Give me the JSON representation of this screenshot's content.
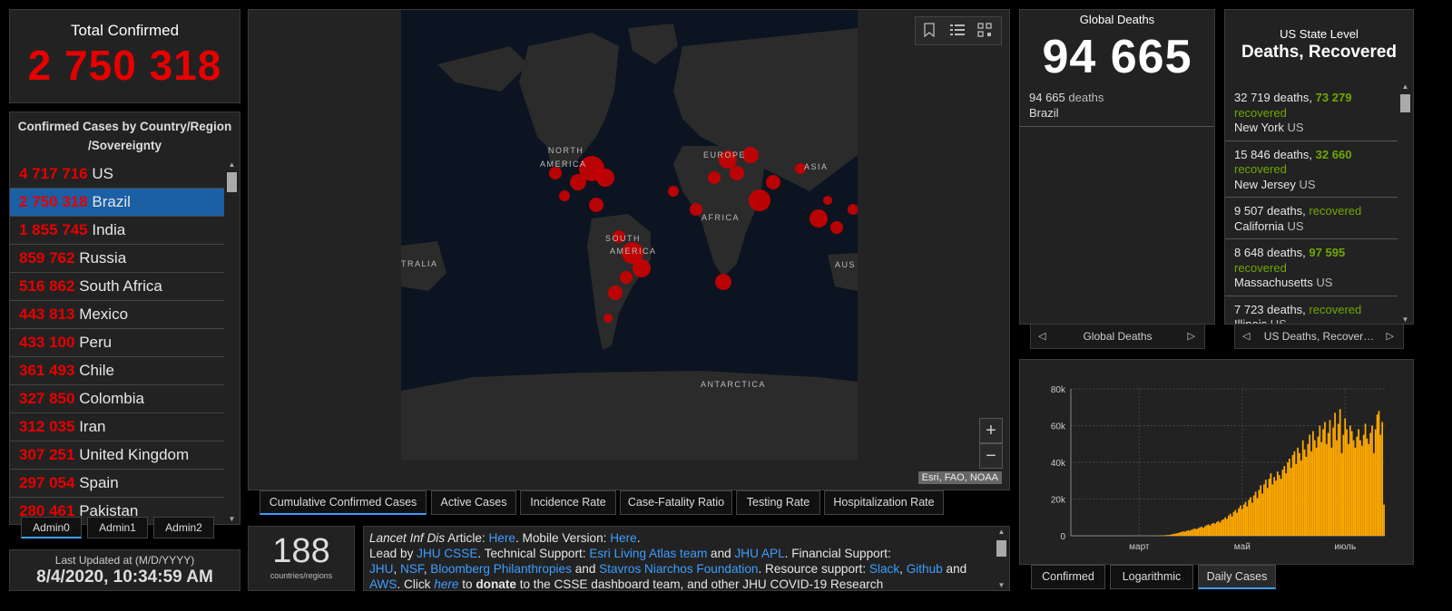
{
  "total": {
    "label": "Total Confirmed",
    "value": "2 750 318"
  },
  "countries": {
    "header": "Confirmed Cases by Country/Region /Sovereignty",
    "rows": [
      {
        "value": "4 717 716",
        "name": "US"
      },
      {
        "value": "2 750 318",
        "name": "Brazil",
        "selected": true
      },
      {
        "value": "1 855 745",
        "name": "India"
      },
      {
        "value": "859 762",
        "name": "Russia"
      },
      {
        "value": "516 862",
        "name": "South Africa"
      },
      {
        "value": "443 813",
        "name": "Mexico"
      },
      {
        "value": "433 100",
        "name": "Peru"
      },
      {
        "value": "361 493",
        "name": "Chile"
      },
      {
        "value": "327 850",
        "name": "Colombia"
      },
      {
        "value": "312 035",
        "name": "Iran"
      },
      {
        "value": "307 251",
        "name": "United Kingdom"
      },
      {
        "value": "297 054",
        "name": "Spain"
      },
      {
        "value": "280 461",
        "name": "Pakistan"
      }
    ]
  },
  "admin_tabs": [
    "Admin0",
    "Admin1",
    "Admin2"
  ],
  "updated": {
    "label": "Last Updated at (M/D/YYYY)",
    "value": "8/4/2020, 10:34:59 AM"
  },
  "map": {
    "labels": {
      "north_america": [
        "NORTH",
        "AMERICA"
      ],
      "south_america": [
        "SOUTH",
        "AMERICA"
      ],
      "europe": "EUROPE",
      "asia": "ASIA",
      "africa": "AFRICA",
      "antarctica": "ANTARCTICA",
      "australia_left": "TRALIA",
      "australia_right": "AUS"
    },
    "attribution": "Esri, FAO, NOAA",
    "zoom_in": "+",
    "zoom_out": "−",
    "tools": [
      "bookmark-icon",
      "layer-list-icon",
      "qr-code-icon"
    ]
  },
  "layer_tabs": [
    "Cumulative Confirmed Cases",
    "Active Cases",
    "Incidence Rate",
    "Case-Fatality Ratio",
    "Testing Rate",
    "Hospitalization Rate"
  ],
  "count": {
    "value": "188",
    "label": "countries/regions"
  },
  "info": {
    "journal": "Lancet Inf Dis",
    "article": " Article: ",
    "here1": "Here",
    "mobile": ". Mobile Version: ",
    "here2": "Here",
    "lead": "Lead by ",
    "jhu_csse": "JHU CSSE",
    "tech": ". Technical Support: ",
    "esri": "Esri Living Atlas team",
    "and1": " and ",
    "jhu_apl": "JHU APL",
    "fin": ". Financial Support: ",
    "jhu": "JHU",
    "nsf": "NSF",
    "bloomberg": "Bloomberg Philanthropies",
    "and2": " and ",
    "snf": "Stavros Niarchos Foundation",
    "res": ". Resource support: ",
    "slack": "Slack",
    "github": "Github",
    "and3": " and ",
    "aws": "AWS",
    "click": ". Click ",
    "here3": "here",
    "to": " to ",
    "donate": "donate",
    "rest": " to the CSSE dashboard team, and other JHU COVID-19 Research"
  },
  "global_deaths": {
    "label": "Global Deaths",
    "value": "94 665",
    "row_value": "94 665",
    "row_unit": " deaths",
    "row_country": "Brazil",
    "nav_label": "Global Deaths"
  },
  "us_states": {
    "title1": "US State Level",
    "title2": "Deaths, Recovered",
    "nav_label": "US Deaths, Recover…",
    "rows": [
      {
        "deaths": "32 719 deaths,",
        "recovered_num": "73 279",
        "recovered_label": "recovered",
        "state": "New York",
        "country": "US"
      },
      {
        "deaths": "15 846 deaths,",
        "recovered_num": "32 660",
        "recovered_label": "recovered",
        "state": "New Jersey",
        "country": "US"
      },
      {
        "deaths": "9 507 deaths,",
        "recovered_num": "",
        "recovered_label": "recovered",
        "state": "California",
        "country": "US"
      },
      {
        "deaths": "8 648 deaths,",
        "recovered_num": "97 595",
        "recovered_label": "recovered",
        "state": "Massachusetts",
        "country": "US"
      },
      {
        "deaths": "7 723 deaths,",
        "recovered_num": "",
        "recovered_label": "recovered",
        "state": "Illinois",
        "country": "US"
      }
    ]
  },
  "chart_tabs": [
    "Confirmed",
    "Logarithmic",
    "Daily Cases"
  ],
  "colors": {
    "accent": "#3d9dff",
    "case_red": "#e60000",
    "recovered_green": "#70a800",
    "bar_orange": "#ffaa00"
  },
  "chart_data": {
    "type": "bar",
    "title": "",
    "xlabel": "",
    "ylabel": "",
    "y_ticks": [
      "0",
      "20k",
      "40k",
      "60k",
      "80k"
    ],
    "ylim": [
      0,
      80000
    ],
    "x_tick_labels": [
      "март",
      "май",
      "июль"
    ],
    "x_tick_days": [
      40,
      101,
      162
    ],
    "grid": true,
    "x_unit": "days since first bar",
    "values": [
      0,
      0,
      0,
      0,
      0,
      0,
      0,
      0,
      0,
      0,
      0,
      0,
      0,
      0,
      0,
      0,
      0,
      0,
      0,
      0,
      0,
      0,
      0,
      0,
      0,
      0,
      0,
      0,
      0,
      0,
      0,
      0,
      0,
      0,
      0,
      0,
      0,
      0,
      0,
      0,
      0,
      0,
      0,
      0,
      0,
      0,
      0,
      0,
      0,
      0,
      50,
      80,
      100,
      150,
      200,
      250,
      350,
      400,
      500,
      700,
      900,
      1100,
      1300,
      1500,
      1800,
      2100,
      2400,
      2200,
      2600,
      3000,
      2800,
      3300,
      3600,
      4000,
      3500,
      4200,
      4600,
      5000,
      4300,
      5200,
      5800,
      6200,
      5500,
      6500,
      7000,
      6600,
      7500,
      8000,
      7200,
      8500,
      9000,
      10000,
      9200,
      11000,
      12000,
      10500,
      13000,
      14000,
      12500,
      15000,
      16500,
      14500,
      17000,
      18500,
      16000,
      19500,
      21000,
      18000,
      22000,
      24000,
      20500,
      25000,
      27500,
      23000,
      28000,
      30500,
      26000,
      31000,
      34000,
      28000,
      32000,
      30000,
      35000,
      33000,
      31000,
      36000,
      38000,
      34000,
      40000,
      42000,
      37000,
      44000,
      46000,
      39000,
      48000,
      45000,
      41000,
      52000,
      47000,
      43000,
      50000,
      55000,
      46000,
      57000,
      52000,
      48000,
      54000,
      60000,
      51000,
      58000,
      62000,
      50000,
      56000,
      63000,
      48000,
      59000,
      67000,
      52000,
      61000,
      69000,
      45000,
      55000,
      64000,
      58000,
      50000,
      60000,
      57000,
      52000,
      48000,
      54000,
      58000,
      52000,
      49000,
      55000,
      61000,
      53000,
      50000,
      56000,
      60000,
      45000,
      58000,
      66000,
      68000,
      55000,
      62000,
      17000
    ]
  }
}
